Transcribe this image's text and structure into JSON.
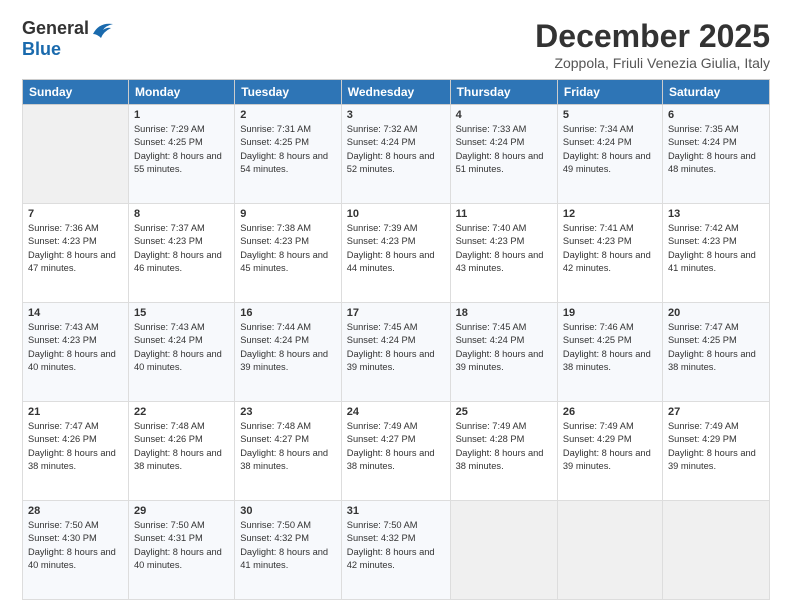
{
  "logo": {
    "general": "General",
    "blue": "Blue"
  },
  "header": {
    "month": "December 2025",
    "location": "Zoppola, Friuli Venezia Giulia, Italy"
  },
  "days_of_week": [
    "Sunday",
    "Monday",
    "Tuesday",
    "Wednesday",
    "Thursday",
    "Friday",
    "Saturday"
  ],
  "weeks": [
    [
      {
        "day": "",
        "sunrise": "",
        "sunset": "",
        "daylight": ""
      },
      {
        "day": "1",
        "sunrise": "Sunrise: 7:29 AM",
        "sunset": "Sunset: 4:25 PM",
        "daylight": "Daylight: 8 hours and 55 minutes."
      },
      {
        "day": "2",
        "sunrise": "Sunrise: 7:31 AM",
        "sunset": "Sunset: 4:25 PM",
        "daylight": "Daylight: 8 hours and 54 minutes."
      },
      {
        "day": "3",
        "sunrise": "Sunrise: 7:32 AM",
        "sunset": "Sunset: 4:24 PM",
        "daylight": "Daylight: 8 hours and 52 minutes."
      },
      {
        "day": "4",
        "sunrise": "Sunrise: 7:33 AM",
        "sunset": "Sunset: 4:24 PM",
        "daylight": "Daylight: 8 hours and 51 minutes."
      },
      {
        "day": "5",
        "sunrise": "Sunrise: 7:34 AM",
        "sunset": "Sunset: 4:24 PM",
        "daylight": "Daylight: 8 hours and 49 minutes."
      },
      {
        "day": "6",
        "sunrise": "Sunrise: 7:35 AM",
        "sunset": "Sunset: 4:24 PM",
        "daylight": "Daylight: 8 hours and 48 minutes."
      }
    ],
    [
      {
        "day": "7",
        "sunrise": "Sunrise: 7:36 AM",
        "sunset": "Sunset: 4:23 PM",
        "daylight": "Daylight: 8 hours and 47 minutes."
      },
      {
        "day": "8",
        "sunrise": "Sunrise: 7:37 AM",
        "sunset": "Sunset: 4:23 PM",
        "daylight": "Daylight: 8 hours and 46 minutes."
      },
      {
        "day": "9",
        "sunrise": "Sunrise: 7:38 AM",
        "sunset": "Sunset: 4:23 PM",
        "daylight": "Daylight: 8 hours and 45 minutes."
      },
      {
        "day": "10",
        "sunrise": "Sunrise: 7:39 AM",
        "sunset": "Sunset: 4:23 PM",
        "daylight": "Daylight: 8 hours and 44 minutes."
      },
      {
        "day": "11",
        "sunrise": "Sunrise: 7:40 AM",
        "sunset": "Sunset: 4:23 PM",
        "daylight": "Daylight: 8 hours and 43 minutes."
      },
      {
        "day": "12",
        "sunrise": "Sunrise: 7:41 AM",
        "sunset": "Sunset: 4:23 PM",
        "daylight": "Daylight: 8 hours and 42 minutes."
      },
      {
        "day": "13",
        "sunrise": "Sunrise: 7:42 AM",
        "sunset": "Sunset: 4:23 PM",
        "daylight": "Daylight: 8 hours and 41 minutes."
      }
    ],
    [
      {
        "day": "14",
        "sunrise": "Sunrise: 7:43 AM",
        "sunset": "Sunset: 4:23 PM",
        "daylight": "Daylight: 8 hours and 40 minutes."
      },
      {
        "day": "15",
        "sunrise": "Sunrise: 7:43 AM",
        "sunset": "Sunset: 4:24 PM",
        "daylight": "Daylight: 8 hours and 40 minutes."
      },
      {
        "day": "16",
        "sunrise": "Sunrise: 7:44 AM",
        "sunset": "Sunset: 4:24 PM",
        "daylight": "Daylight: 8 hours and 39 minutes."
      },
      {
        "day": "17",
        "sunrise": "Sunrise: 7:45 AM",
        "sunset": "Sunset: 4:24 PM",
        "daylight": "Daylight: 8 hours and 39 minutes."
      },
      {
        "day": "18",
        "sunrise": "Sunrise: 7:45 AM",
        "sunset": "Sunset: 4:24 PM",
        "daylight": "Daylight: 8 hours and 39 minutes."
      },
      {
        "day": "19",
        "sunrise": "Sunrise: 7:46 AM",
        "sunset": "Sunset: 4:25 PM",
        "daylight": "Daylight: 8 hours and 38 minutes."
      },
      {
        "day": "20",
        "sunrise": "Sunrise: 7:47 AM",
        "sunset": "Sunset: 4:25 PM",
        "daylight": "Daylight: 8 hours and 38 minutes."
      }
    ],
    [
      {
        "day": "21",
        "sunrise": "Sunrise: 7:47 AM",
        "sunset": "Sunset: 4:26 PM",
        "daylight": "Daylight: 8 hours and 38 minutes."
      },
      {
        "day": "22",
        "sunrise": "Sunrise: 7:48 AM",
        "sunset": "Sunset: 4:26 PM",
        "daylight": "Daylight: 8 hours and 38 minutes."
      },
      {
        "day": "23",
        "sunrise": "Sunrise: 7:48 AM",
        "sunset": "Sunset: 4:27 PM",
        "daylight": "Daylight: 8 hours and 38 minutes."
      },
      {
        "day": "24",
        "sunrise": "Sunrise: 7:49 AM",
        "sunset": "Sunset: 4:27 PM",
        "daylight": "Daylight: 8 hours and 38 minutes."
      },
      {
        "day": "25",
        "sunrise": "Sunrise: 7:49 AM",
        "sunset": "Sunset: 4:28 PM",
        "daylight": "Daylight: 8 hours and 38 minutes."
      },
      {
        "day": "26",
        "sunrise": "Sunrise: 7:49 AM",
        "sunset": "Sunset: 4:29 PM",
        "daylight": "Daylight: 8 hours and 39 minutes."
      },
      {
        "day": "27",
        "sunrise": "Sunrise: 7:49 AM",
        "sunset": "Sunset: 4:29 PM",
        "daylight": "Daylight: 8 hours and 39 minutes."
      }
    ],
    [
      {
        "day": "28",
        "sunrise": "Sunrise: 7:50 AM",
        "sunset": "Sunset: 4:30 PM",
        "daylight": "Daylight: 8 hours and 40 minutes."
      },
      {
        "day": "29",
        "sunrise": "Sunrise: 7:50 AM",
        "sunset": "Sunset: 4:31 PM",
        "daylight": "Daylight: 8 hours and 40 minutes."
      },
      {
        "day": "30",
        "sunrise": "Sunrise: 7:50 AM",
        "sunset": "Sunset: 4:32 PM",
        "daylight": "Daylight: 8 hours and 41 minutes."
      },
      {
        "day": "31",
        "sunrise": "Sunrise: 7:50 AM",
        "sunset": "Sunset: 4:32 PM",
        "daylight": "Daylight: 8 hours and 42 minutes."
      },
      {
        "day": "",
        "sunrise": "",
        "sunset": "",
        "daylight": ""
      },
      {
        "day": "",
        "sunrise": "",
        "sunset": "",
        "daylight": ""
      },
      {
        "day": "",
        "sunrise": "",
        "sunset": "",
        "daylight": ""
      }
    ]
  ]
}
